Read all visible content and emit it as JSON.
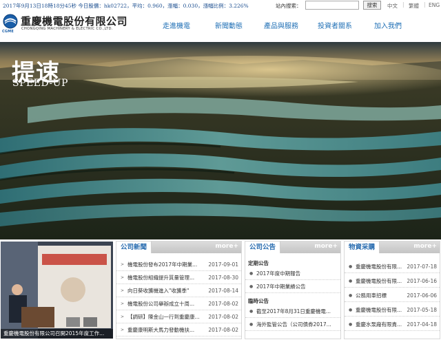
{
  "topbar": {
    "ticker": "2017年9月13日18時18分45秒 今日股價：hk02722，平均：0.960，漲幅：0.030，漲幅比例：3.226%",
    "search_label": "站內搜索：",
    "search_value": "",
    "search_button": "搜索",
    "langs": [
      "中文",
      "繁體",
      "ENG"
    ]
  },
  "header": {
    "logo_short": "CGME",
    "logo_cn": "重慶機電股份有限公司",
    "logo_en": "CHONGQING MACHINERY & ELECTRIC CO.,LTD.",
    "nav": [
      "走進機電",
      "新聞動態",
      "產品與服務",
      "投資者關系",
      "加入我們"
    ]
  },
  "banner": {
    "title": "提速",
    "subtitle": "SPEED-UP"
  },
  "photo": {
    "caption": "重慶機電股份有限公司召開2015年度工作..."
  },
  "news": {
    "title": "公司新聞",
    "more": "more+",
    "items": [
      {
        "title": "機電股份發布2017年中期業...",
        "date": "2017-09-01"
      },
      {
        "title": "機電股份組織提升質量管理...",
        "date": "2017-08-30"
      },
      {
        "title": "向日葵收獲機進入\"收獲季\"",
        "date": "2017-08-14"
      },
      {
        "title": "機電股份公司舉辦成立十周...",
        "date": "2017-08-02"
      },
      {
        "title": "【調研】陳金山一行到重慶康...",
        "date": "2017-08-02"
      },
      {
        "title": "重慶康明斯大馬力發動機扶...",
        "date": "2017-08-02"
      }
    ]
  },
  "announce": {
    "title": "公司公告",
    "more": "more+",
    "regular_label": "定期公告",
    "regular": [
      "2017年度中期報告",
      "2017年中期業績公告"
    ],
    "temp_label": "臨時公告",
    "temp": [
      "截至2017年8月31日重慶機電...",
      "海外監管公告（公司債券2017..."
    ]
  },
  "purchase": {
    "title": "物資采購",
    "more": "more+",
    "items": [
      {
        "title": "重慶機電股份有限...",
        "date": "2017-07-18"
      },
      {
        "title": "重慶機電股份有限...",
        "date": "2017-06-16"
      },
      {
        "title": "公務用車招標",
        "date": "2017-06-06"
      },
      {
        "title": "重慶機電股份有限...",
        "date": "2017-05-18"
      },
      {
        "title": "重慶水泵廠有限責...",
        "date": "2017-04-18"
      }
    ]
  }
}
